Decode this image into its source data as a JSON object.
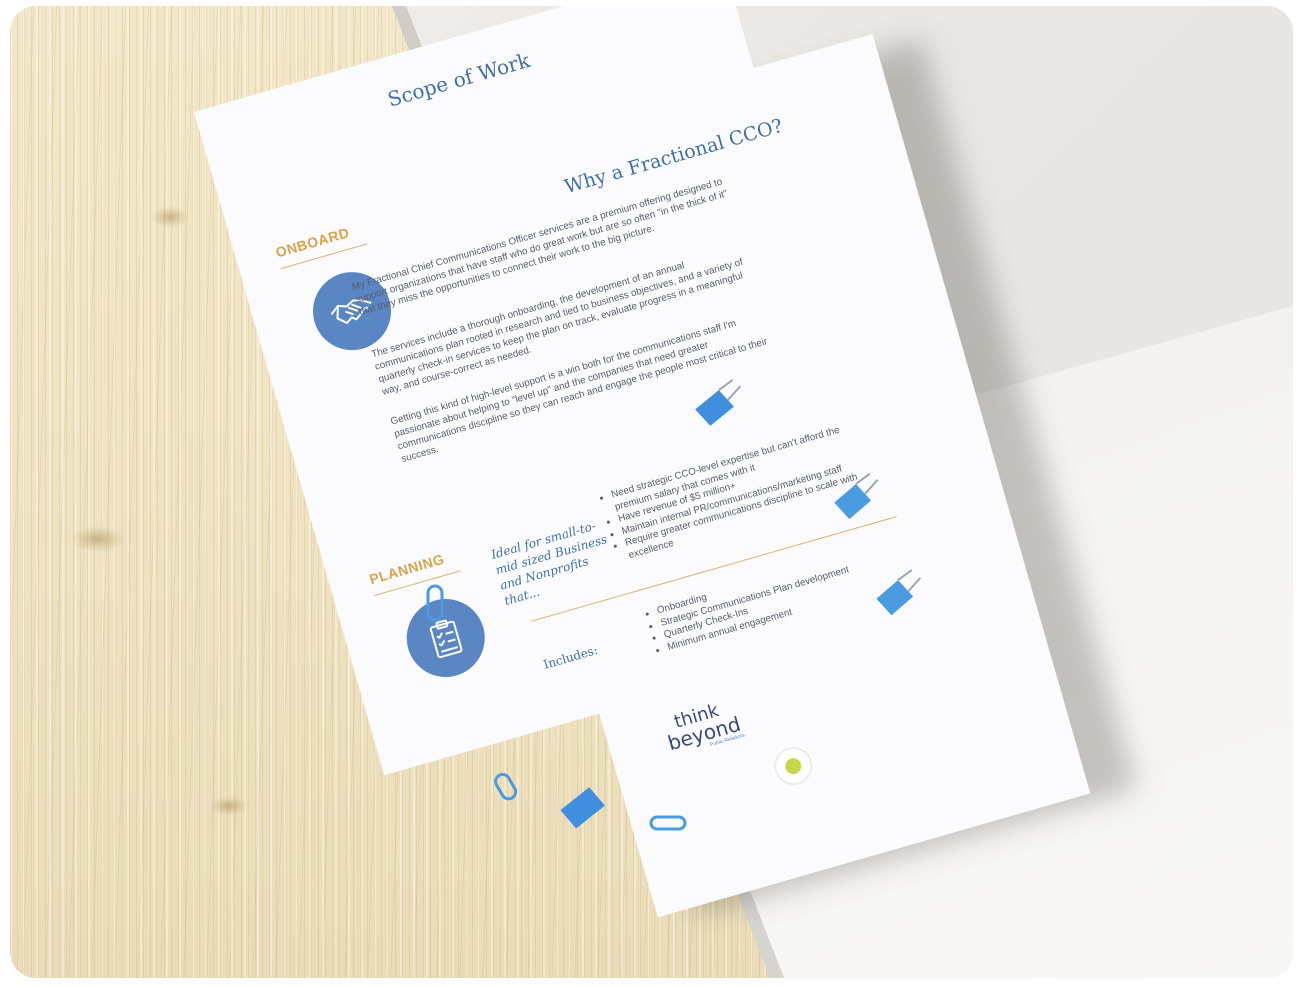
{
  "back_sheet": {
    "title": "Scope of Work",
    "sections": [
      {
        "label": "ONBOARD",
        "icon": "handshake-icon"
      },
      {
        "label": "PLANNING",
        "icon": "clipboard-checklist-icon"
      }
    ]
  },
  "front_sheet": {
    "title": "Why a Fractional CCO?",
    "paragraphs": [
      "My Fractional Chief Communications Officer services are a premium offering designed to support organizations that have staff who do great work but are so often \"in the thick of it\" that they miss the opportunities to connect their work to the big picture.",
      "The services include a thorough onboarding, the development of an annual communications plan rooted in research and tied to business objectives, and a variety of quarterly check-in services to keep the plan on track, evaluate progress in a meaningful way, and course-correct as needed.",
      "Getting this kind of high-level support is a win both for the communications staff I'm passionate about helping to \"level up\" and the companies that need greater communications discipline so they can reach and engage the people most critical to their success."
    ],
    "ideal_heading": "Ideal for small-to-mid sized Business and Nonprofits that...",
    "ideal_items": [
      "Need strategic CCO-level expertise but can't afford the premium salary that comes with it",
      "Have revenue of $5 million+",
      "Maintain internal PR/communications/marketing staff",
      "Require greater communications discipline to scale with excellence"
    ],
    "includes_heading": "Includes:",
    "includes_items": [
      "Onboarding",
      "Strategic Communications Plan development",
      "Quarterly Check-Ins",
      "Minimum annual engagement"
    ],
    "logo": {
      "line1": "think",
      "line2": "beyond",
      "tagline": "Public Relations"
    }
  },
  "colors": {
    "title_blue": "#3f6ea8",
    "accent_orange": "#d8a34c",
    "icon_blue": "#5b86c4",
    "clip_blue": "#4a9be0",
    "wood": "#efe3c2",
    "wall": "#ebe9e5"
  }
}
